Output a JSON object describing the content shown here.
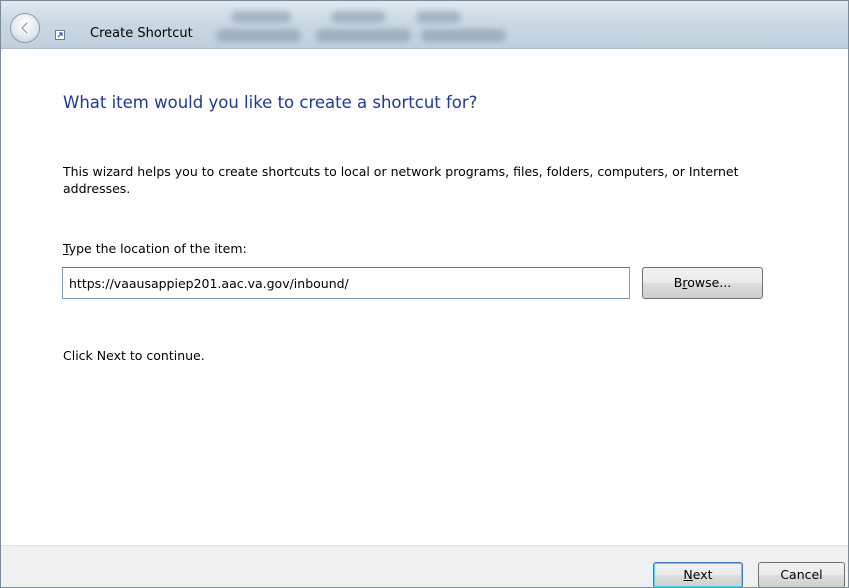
{
  "window": {
    "title": "Create Shortcut"
  },
  "wizard": {
    "heading": "What item would you like to create a shortcut for?",
    "description": "This wizard helps you to create shortcuts to local or network programs, files, folders, computers, or Internet addresses.",
    "location_label_mnemonic": "T",
    "location_label_rest": "ype the location of the item:",
    "location_value": "https://vaausappiep201.aac.va.gov/inbound/",
    "browse_mnemonic": "r",
    "browse_pre": "B",
    "browse_post": "owse...",
    "hint": "Click Next to continue."
  },
  "footer": {
    "next_mnemonic": "N",
    "next_rest": "ext",
    "cancel_label": "Cancel"
  },
  "colors": {
    "heading": "#1e3a8f",
    "titlebar": "#c9d9e4",
    "footer": "#f0f0f0"
  },
  "icons": {
    "back": "back-arrow-icon",
    "app": "shortcut-icon"
  }
}
